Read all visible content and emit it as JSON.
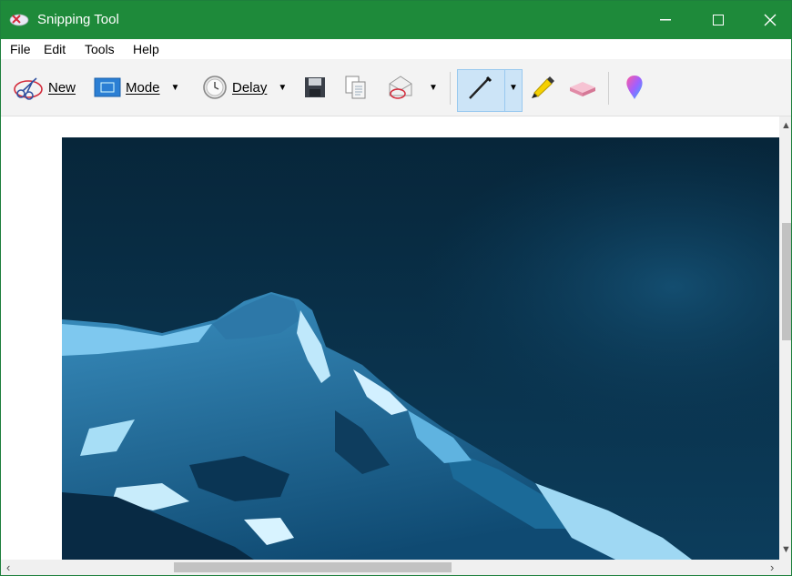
{
  "window": {
    "title": "Snipping Tool"
  },
  "menu": {
    "items": [
      "File",
      "Edit",
      "Tools",
      "Help"
    ]
  },
  "toolbar": {
    "new_label": "New",
    "mode_label": "Mode",
    "delay_label": "Delay"
  },
  "colors": {
    "titlebar": "#1e8a3a",
    "toolbar": "#f3f3f3",
    "pen_selected": "#cce4f7",
    "highlighter": "#f5d000",
    "eraser": "#f0a9bf"
  },
  "icons": [
    "snipping-tool-app-icon",
    "new-snip-icon",
    "mode-icon",
    "delay-clock-icon",
    "save-icon",
    "copy-icon",
    "send-snip-icon",
    "pen-icon",
    "highlighter-icon",
    "eraser-icon",
    "paint3d-icon"
  ]
}
